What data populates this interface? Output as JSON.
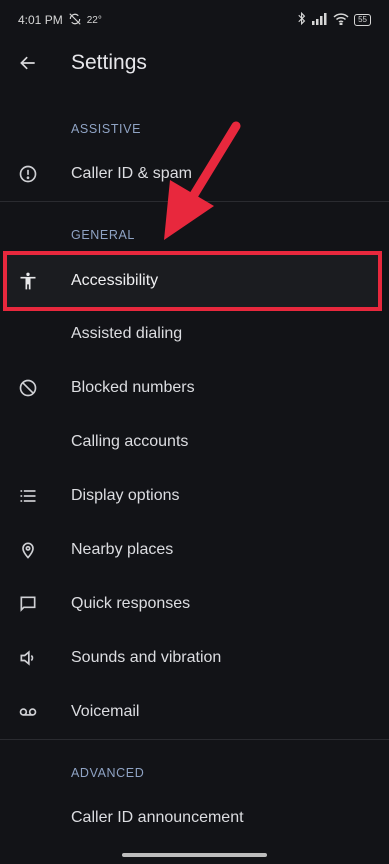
{
  "status_bar": {
    "time": "4:01 PM",
    "temperature": "22°",
    "battery": "55"
  },
  "app_bar": {
    "title": "Settings"
  },
  "sections": {
    "assistive": {
      "header": "ASSISTIVE",
      "items": [
        {
          "label": "Caller ID & spam",
          "icon": "alert-circle-icon"
        }
      ]
    },
    "general": {
      "header": "GENERAL",
      "items": [
        {
          "label": "Accessibility",
          "icon": "accessibility-icon"
        },
        {
          "label": "Assisted dialing",
          "icon": ""
        },
        {
          "label": "Blocked numbers",
          "icon": "block-icon"
        },
        {
          "label": "Calling accounts",
          "icon": ""
        },
        {
          "label": "Display options",
          "icon": "list-icon"
        },
        {
          "label": "Nearby places",
          "icon": "location-pin-icon"
        },
        {
          "label": "Quick responses",
          "icon": "chat-bubble-icon"
        },
        {
          "label": "Sounds and vibration",
          "icon": "volume-icon"
        },
        {
          "label": "Voicemail",
          "icon": "voicemail-icon"
        }
      ]
    },
    "advanced": {
      "header": "ADVANCED",
      "items": [
        {
          "label": "Caller ID announcement",
          "icon": ""
        }
      ]
    }
  },
  "colors": {
    "background": "#121317",
    "highlight_border": "#e8283d",
    "section_header": "#8fa3c4"
  }
}
